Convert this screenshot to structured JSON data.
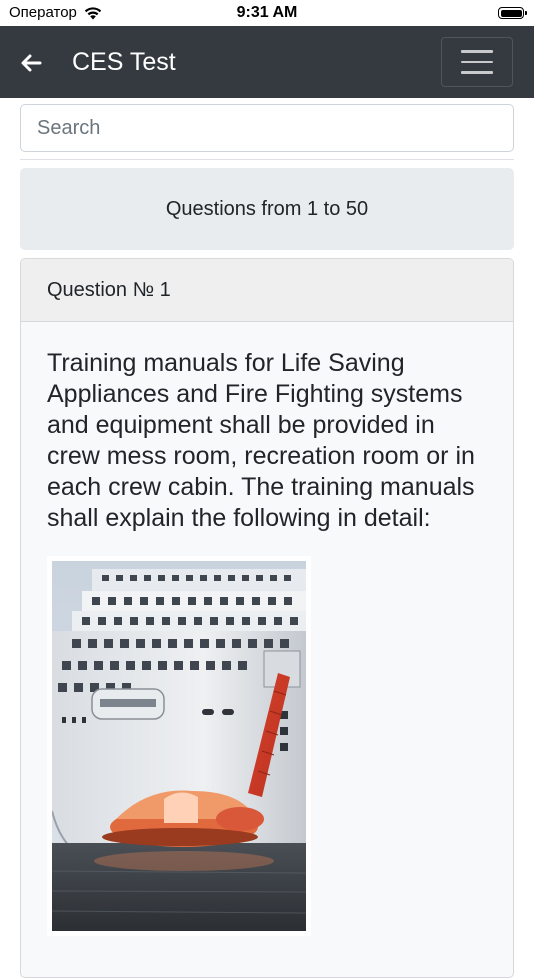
{
  "status_bar": {
    "carrier": "Оператор",
    "time": "9:31 AM"
  },
  "navbar": {
    "title": "CES Test",
    "back_icon": "arrow-left-icon",
    "menu_icon": "hamburger-icon",
    "background": "#343a40"
  },
  "search": {
    "placeholder": "Search",
    "value": ""
  },
  "range_banner": {
    "label": "Questions from 1 to 50"
  },
  "question": {
    "header": "Question № 1",
    "text": "Training manuals for Life Saving Appliances and Fire Fighting systems and equipment shall be provided in crew mess room, recreation room or in each crew cabin. The training manuals shall explain the following in detail:",
    "image": "cruise-ship-lifeboat-photo"
  }
}
